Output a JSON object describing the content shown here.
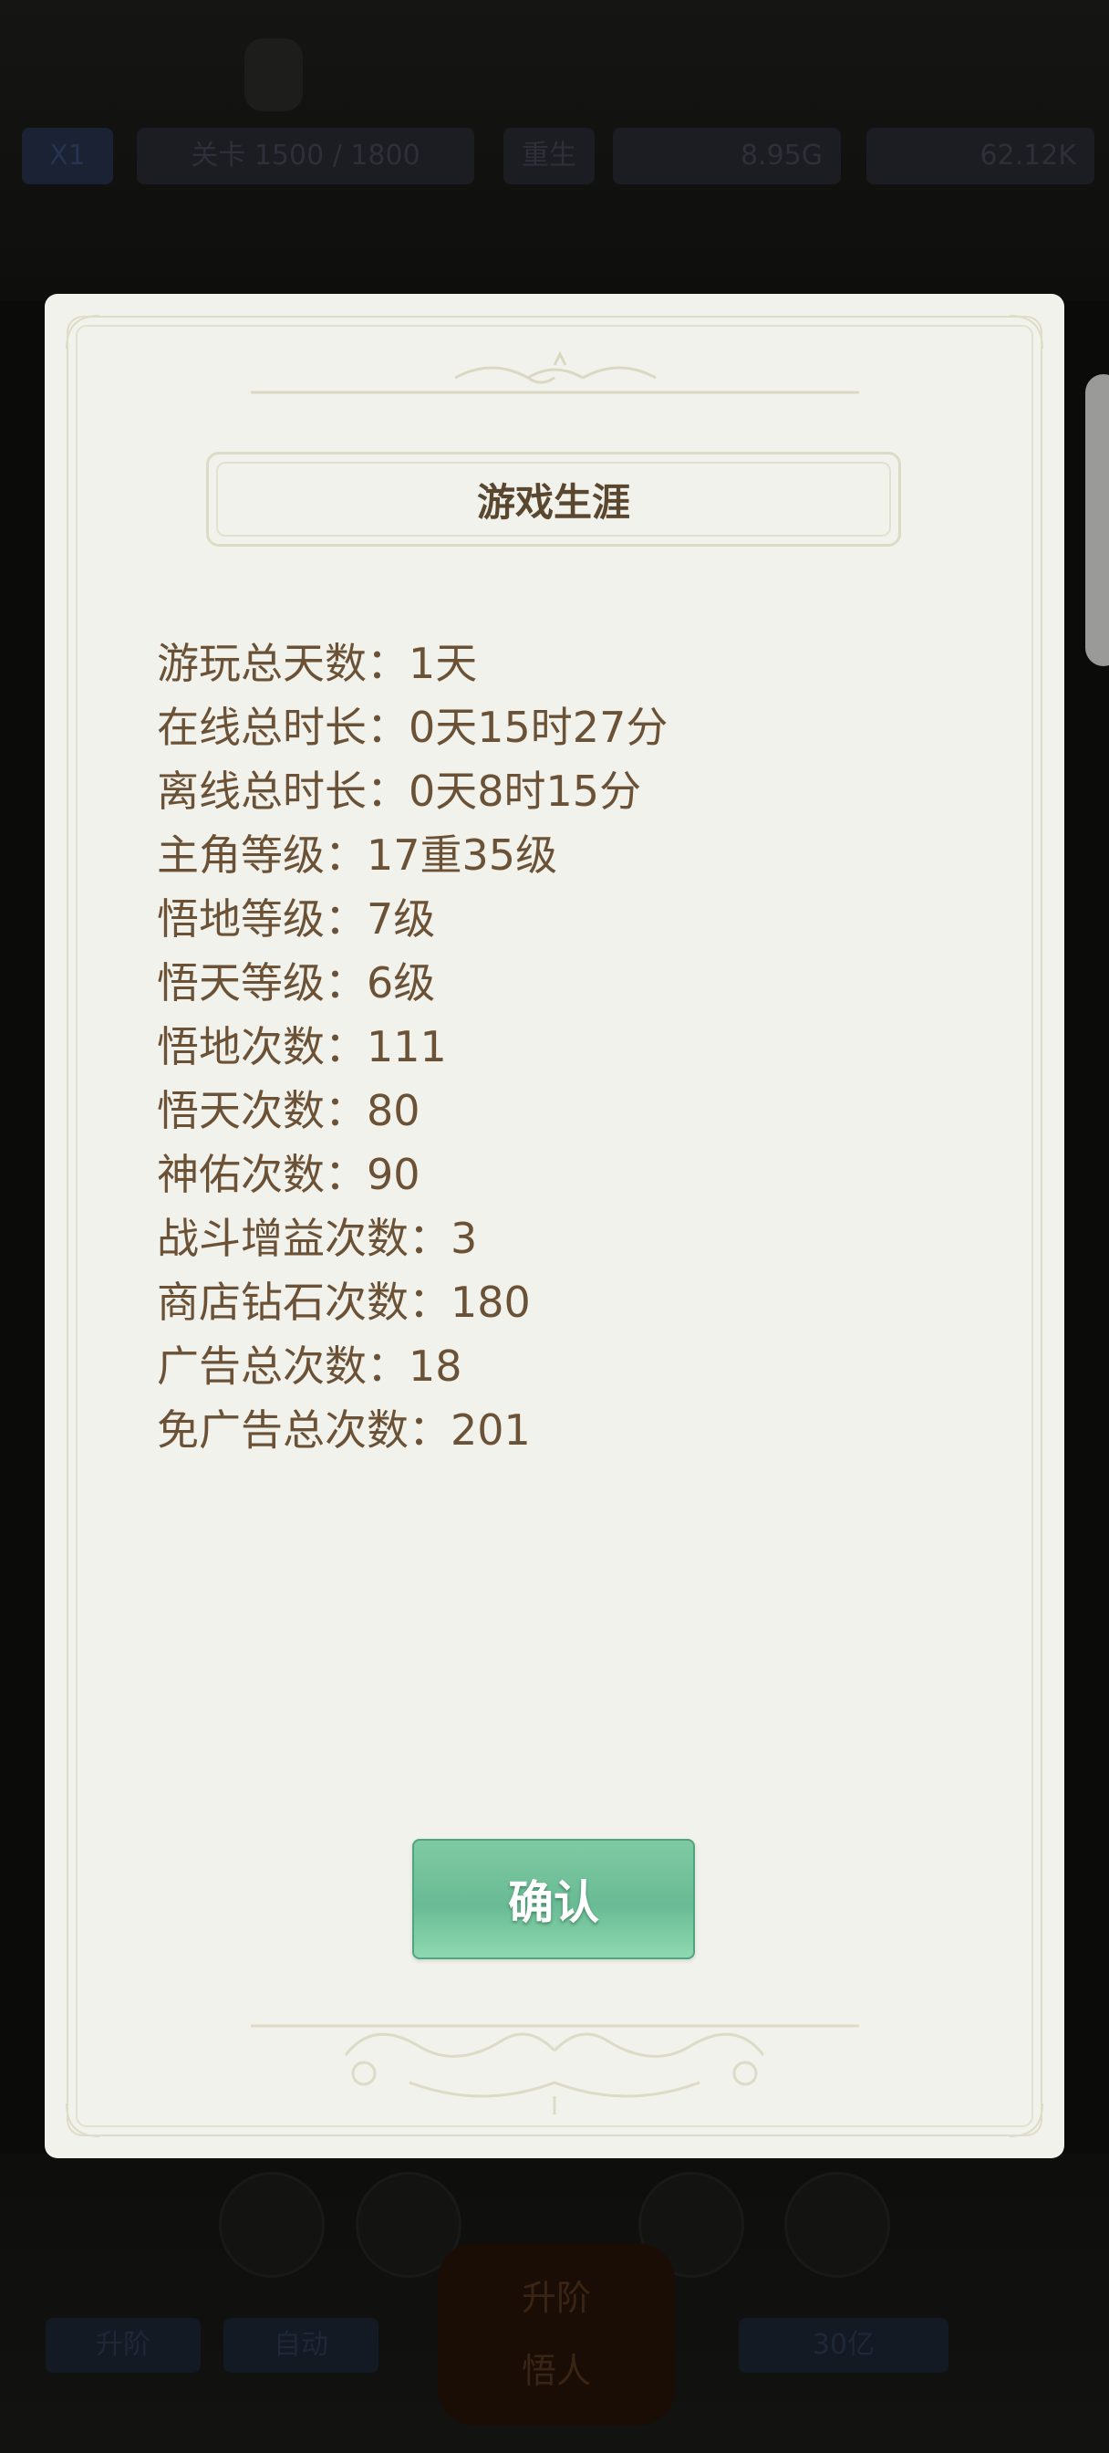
{
  "background": {
    "hud": {
      "speed": "X1",
      "stage": "关卡 1500 / 1800",
      "rebirth": "重生",
      "gold": "8.95G",
      "gems": "62.12K"
    },
    "bottom": {
      "btn_left": "升阶",
      "btn_auto": "自动",
      "big_title": "升阶",
      "big_sub": "悟人",
      "right_value": "30亿"
    }
  },
  "dialog": {
    "title": "游戏生涯",
    "stats": [
      {
        "label": "游玩总天数",
        "value": "1天"
      },
      {
        "label": "在线总时长",
        "value": "0天15时27分"
      },
      {
        "label": "离线总时长",
        "value": "0天8时15分"
      },
      {
        "label": "主角等级",
        "value": "17重35级"
      },
      {
        "label": "悟地等级",
        "value": "7级"
      },
      {
        "label": "悟天等级",
        "value": "6级"
      },
      {
        "label": "悟地次数",
        "value": "111"
      },
      {
        "label": "悟天次数",
        "value": "80"
      },
      {
        "label": "神佑次数",
        "value": "90"
      },
      {
        "label": "战斗增益次数",
        "value": "3"
      },
      {
        "label": "商店钻石次数",
        "value": "180"
      },
      {
        "label": "广告总次数",
        "value": "18"
      },
      {
        "label": "免广告总次数",
        "value": "201"
      }
    ],
    "separator": "：",
    "confirm_label": "确认"
  },
  "colors": {
    "dialog_bg": "#f2f2ec",
    "text": "#6b5236",
    "title": "#5a4730",
    "button": "#72c29b"
  }
}
